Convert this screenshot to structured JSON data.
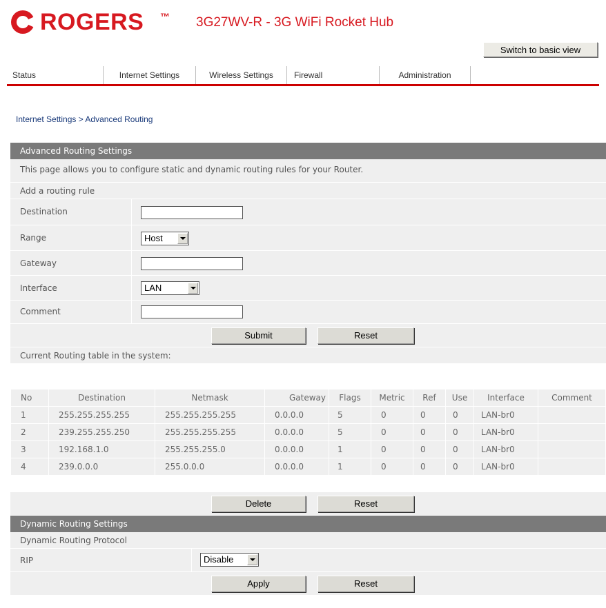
{
  "header": {
    "brand": "ROGERS",
    "trademark": "™",
    "model": "3G27WV-R - 3G WiFi Rocket Hub",
    "switch_view_label": "Switch to basic view",
    "brand_color": "#d71920"
  },
  "tabs": [
    {
      "label": "Status"
    },
    {
      "label": "Internet Settings"
    },
    {
      "label": "Wireless Settings"
    },
    {
      "label": "Firewall"
    },
    {
      "label": "Administration"
    }
  ],
  "breadcrumb": "Internet Settings > Advanced Routing",
  "advanced": {
    "title": "Advanced Routing Settings",
    "description": "This page allows you to configure static and dynamic routing rules for your Router.",
    "add_rule_label": "Add a routing rule",
    "fields": {
      "destination_label": "Destination",
      "destination_value": "",
      "range_label": "Range",
      "range_value": "Host",
      "gateway_label": "Gateway",
      "gateway_value": "",
      "interface_label": "Interface",
      "interface_value": "LAN",
      "comment_label": "Comment",
      "comment_value": ""
    },
    "submit_label": "Submit",
    "reset_label": "Reset"
  },
  "routing_table": {
    "title": "Current Routing table in the system:",
    "columns": [
      "No",
      "Destination",
      "Netmask",
      "Gateway",
      "Flags",
      "Metric",
      "Ref",
      "Use",
      "Interface",
      "Comment"
    ],
    "rows": [
      [
        "1",
        "255.255.255.255",
        "255.255.255.255",
        "0.0.0.0",
        "5",
        "0",
        "0",
        "0",
        "LAN-br0",
        ""
      ],
      [
        "2",
        "239.255.255.250",
        "255.255.255.255",
        "0.0.0.0",
        "5",
        "0",
        "0",
        "0",
        "LAN-br0",
        ""
      ],
      [
        "3",
        "192.168.1.0",
        "255.255.255.0",
        "0.0.0.0",
        "1",
        "0",
        "0",
        "0",
        "LAN-br0",
        ""
      ],
      [
        "4",
        "239.0.0.0",
        "255.0.0.0",
        "0.0.0.0",
        "1",
        "0",
        "0",
        "0",
        "LAN-br0",
        ""
      ]
    ],
    "delete_label": "Delete",
    "reset_label": "Reset"
  },
  "dynamic": {
    "title": "Dynamic Routing Settings",
    "protocol_label": "Dynamic Routing Protocol",
    "rip_label": "RIP",
    "rip_value": "Disable",
    "apply_label": "Apply",
    "reset_label": "Reset"
  }
}
